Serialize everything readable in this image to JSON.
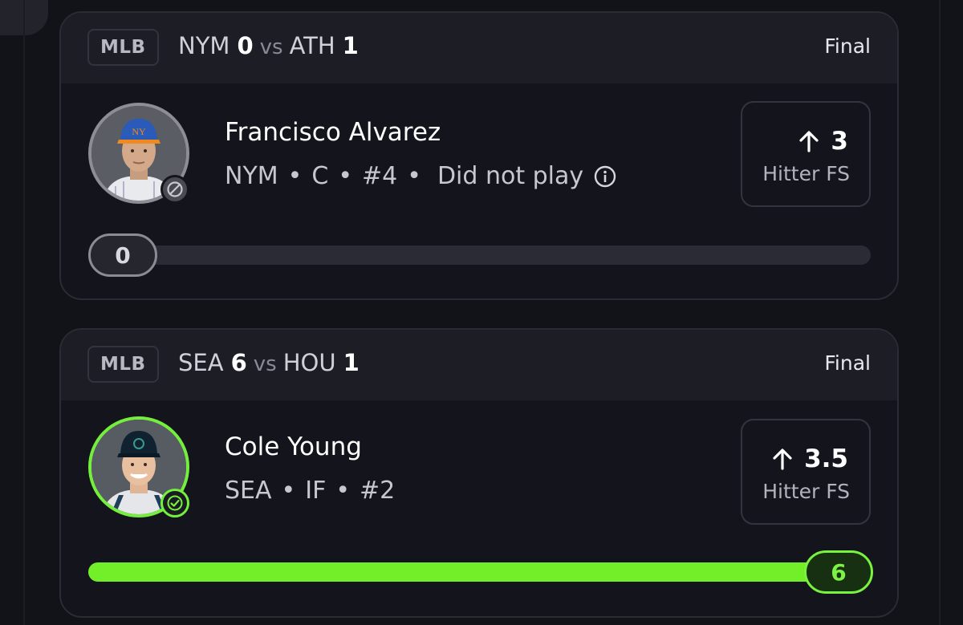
{
  "cards": [
    {
      "league": "MLB",
      "home_team": "NYM",
      "home_score": "0",
      "vs": "vs",
      "away_team": "ATH",
      "away_score": "1",
      "status": "Final",
      "player": {
        "name": "Francisco Alvarez",
        "team": "NYM",
        "position": "C",
        "number": "#4",
        "note": "Did not play",
        "status_icon": "ban-icon",
        "photo_desc": "player-headshot"
      },
      "projection": {
        "direction": "up-arrow-icon",
        "value": "3",
        "label": "Hitter FS"
      },
      "result": {
        "value": "0",
        "fill_fraction": 0.0
      }
    },
    {
      "league": "MLB",
      "home_team": "SEA",
      "home_score": "6",
      "vs": "vs",
      "away_team": "HOU",
      "away_score": "1",
      "status": "Final",
      "player": {
        "name": "Cole Young",
        "team": "SEA",
        "position": "IF",
        "number": "#2",
        "status_icon": "check-icon",
        "photo_desc": "player-headshot"
      },
      "projection": {
        "direction": "up-arrow-icon",
        "value": "3.5",
        "label": "Hitter FS"
      },
      "result": {
        "value": "6",
        "fill_fraction": 1.0
      }
    }
  ],
  "colors": {
    "accent_green": "#73ef2a",
    "background": "#121219",
    "card": "#14141c"
  },
  "separator": "•"
}
